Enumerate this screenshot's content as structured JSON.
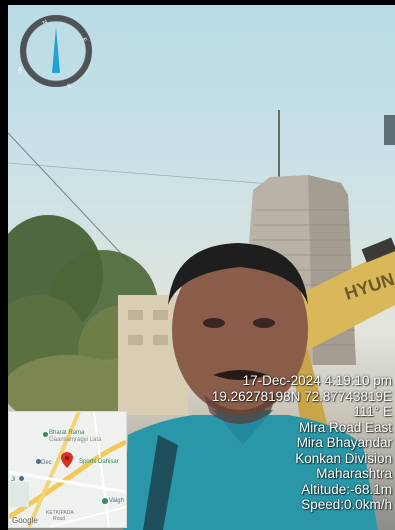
{
  "stamp": {
    "datetime": "17-Dec-2024 4:19:10 pm",
    "coordinates": "19.26278198N 72.87743819E",
    "heading": "111° E",
    "locality": "Mira Road East",
    "city": "Mira Bhayandar",
    "division": "Konkan Division",
    "state": "Maharashtra",
    "altitude": "Altitude:-68.1m",
    "speed": "Speed:0.0km/h"
  },
  "compass": {
    "north": "N",
    "east": "E",
    "south": "S",
    "west": "W"
  },
  "map": {
    "place_1_line1": "Bharat Rama",
    "place_1_line2": "Gaansamragyi Lata",
    "place_2_prefix": "Dec",
    "place_2": "Sports Dahisar",
    "place_3": "Vaigh",
    "road_label": "KETKIPADA",
    "road_label_2": "Road",
    "edge_label": "Jl",
    "brand": "Google"
  },
  "photo": {
    "machine_text": "HYUN"
  },
  "colors": {
    "compass_needle": "#1fa2d6",
    "map_pin": "#d93025",
    "stamp_text": "#ffffff"
  }
}
